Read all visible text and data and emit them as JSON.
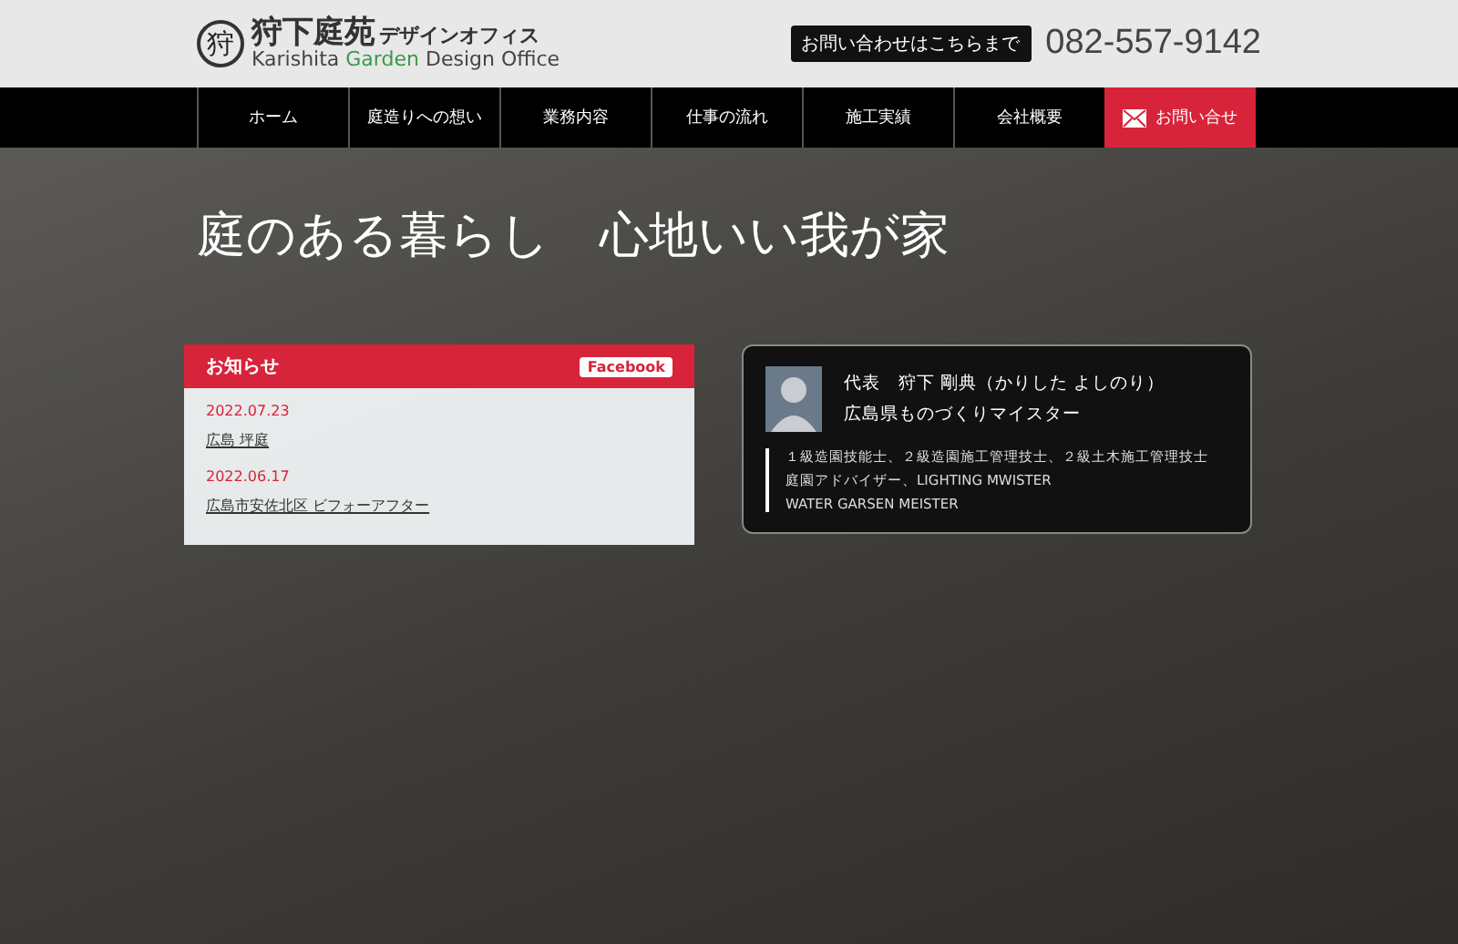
{
  "header": {
    "logo_mark": "狩",
    "logo_title": "狩下庭苑",
    "logo_title_suffix": "デザインオフィス",
    "logo_subtitle": [
      {
        "text": "Karishita ",
        "accent": false
      },
      {
        "text": "Garden",
        "accent": true
      },
      {
        "text": " Design Office",
        "accent": false
      }
    ],
    "contact_label": "お問い合わせはこちらまで",
    "phone": "082-557-9142"
  },
  "nav": [
    {
      "label": "ホーム",
      "kind": "link"
    },
    {
      "label": "庭造りへの想い",
      "kind": "link"
    },
    {
      "label": "業務内容",
      "kind": "link"
    },
    {
      "label": "仕事の流れ",
      "kind": "link"
    },
    {
      "label": "施工実績",
      "kind": "link"
    },
    {
      "label": "会社概要",
      "kind": "link"
    },
    {
      "label": "お問い合せ",
      "kind": "contact"
    }
  ],
  "hero": {
    "tagline": "庭のある暮らし　心地いい我が家"
  },
  "news": {
    "title": "お知らせ",
    "facebook": "Facebook",
    "items": [
      {
        "date": "2022.07.23",
        "title": "広島 坪庭"
      },
      {
        "date": "2022.06.17",
        "title": "広島市安佐北区 ビフォーアフター"
      }
    ]
  },
  "profile": {
    "name": "代表　狩下 剛典（かりした よしのり）",
    "role": "広島県ものづくりマイスター",
    "qualifications": [
      "１級造園技能士、２級造園施工管理技士、２級土木施工管理技士",
      "庭園アドバイザー、LIGHTING MWISTER",
      "WATER GARSEN MEISTER"
    ]
  }
}
